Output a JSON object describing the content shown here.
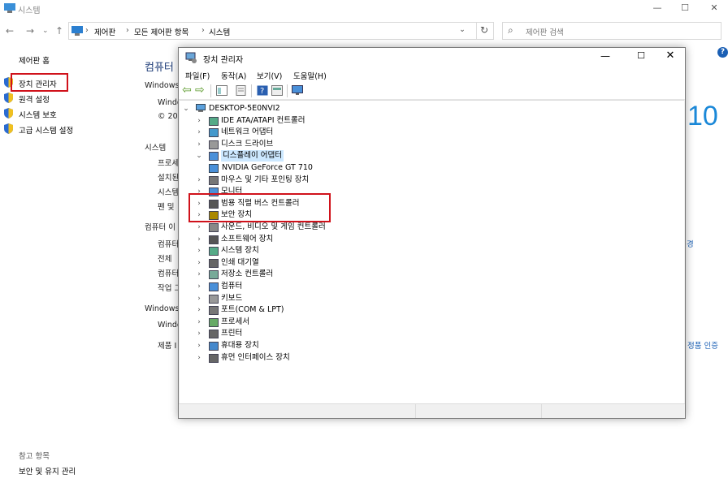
{
  "background": {
    "window_title": "시스템",
    "breadcrumb": [
      "제어판",
      "모든 제어판 항목",
      "시스템"
    ],
    "search_placeholder": "제어판 검색",
    "sidebar": {
      "home": "제어판 홈",
      "items": [
        "장치 관리자",
        "원격 설정",
        "시스템 보호",
        "고급 시스템 설정"
      ],
      "see_also_title": "참고 항목",
      "see_also": [
        "보안 및 유지 관리"
      ]
    },
    "main_title_fragment": "컴퓨터",
    "partial": {
      "windows1": "Windows",
      "windo1": "Windo",
      "copy": "© 20",
      "system": "시스템",
      "proc": "프로세",
      "inst": "설치된",
      "systype": "시스템",
      "pen": "펜 및",
      "compname": "컴퓨터 이",
      "cn1": "컴퓨터",
      "full": "전체 ",
      "cn2": "컴퓨터",
      "work": "작업 그",
      "windows2": "Windows",
      "windo2": "Windo",
      "product": "제품 I"
    },
    "win_ver": "10",
    "right_link1": "경",
    "right_link2": "정품 인증"
  },
  "device_manager": {
    "title": "장치 관리자",
    "menu": [
      "파일(F)",
      "동작(A)",
      "보기(V)",
      "도움말(H)"
    ],
    "root": "DESKTOP-5E0NVI2",
    "tree": [
      {
        "label": "IDE ATA/ATAPI 컨트롤러",
        "icon": "ide-controller-icon"
      },
      {
        "label": "네트워크 어댑터",
        "icon": "network-adapter-icon"
      },
      {
        "label": "디스크 드라이브",
        "icon": "disk-drive-icon"
      },
      {
        "label": "디스플레이 어댑터",
        "icon": "display-adapter-icon",
        "expanded": true,
        "children": [
          "NVIDIA GeForce GT 710"
        ]
      },
      {
        "label": "마우스 및 기타 포인팅 장치",
        "icon": "mouse-icon"
      },
      {
        "label": "모니터",
        "icon": "monitor-icon"
      },
      {
        "label": "범용 직렬 버스 컨트롤러",
        "icon": "usb-icon"
      },
      {
        "label": "보안 장치",
        "icon": "security-device-icon"
      },
      {
        "label": "사운드, 비디오 및 게임 컨트롤러",
        "icon": "sound-icon"
      },
      {
        "label": "소프트웨어 장치",
        "icon": "software-device-icon"
      },
      {
        "label": "시스템 장치",
        "icon": "system-device-icon"
      },
      {
        "label": "인쇄 대기열",
        "icon": "print-queue-icon"
      },
      {
        "label": "저장소 컨트롤러",
        "icon": "storage-controller-icon"
      },
      {
        "label": "컴퓨터",
        "icon": "computer-icon"
      },
      {
        "label": "키보드",
        "icon": "keyboard-icon"
      },
      {
        "label": "포트(COM & LPT)",
        "icon": "port-icon"
      },
      {
        "label": "프로세서",
        "icon": "processor-icon"
      },
      {
        "label": "프린터",
        "icon": "printer-icon"
      },
      {
        "label": "휴대용 장치",
        "icon": "portable-device-icon"
      },
      {
        "label": "휴먼 인터페이스 장치",
        "icon": "hid-icon"
      }
    ]
  },
  "colors": {
    "highlight": "#d0121b",
    "link": "#1a5fb4"
  }
}
